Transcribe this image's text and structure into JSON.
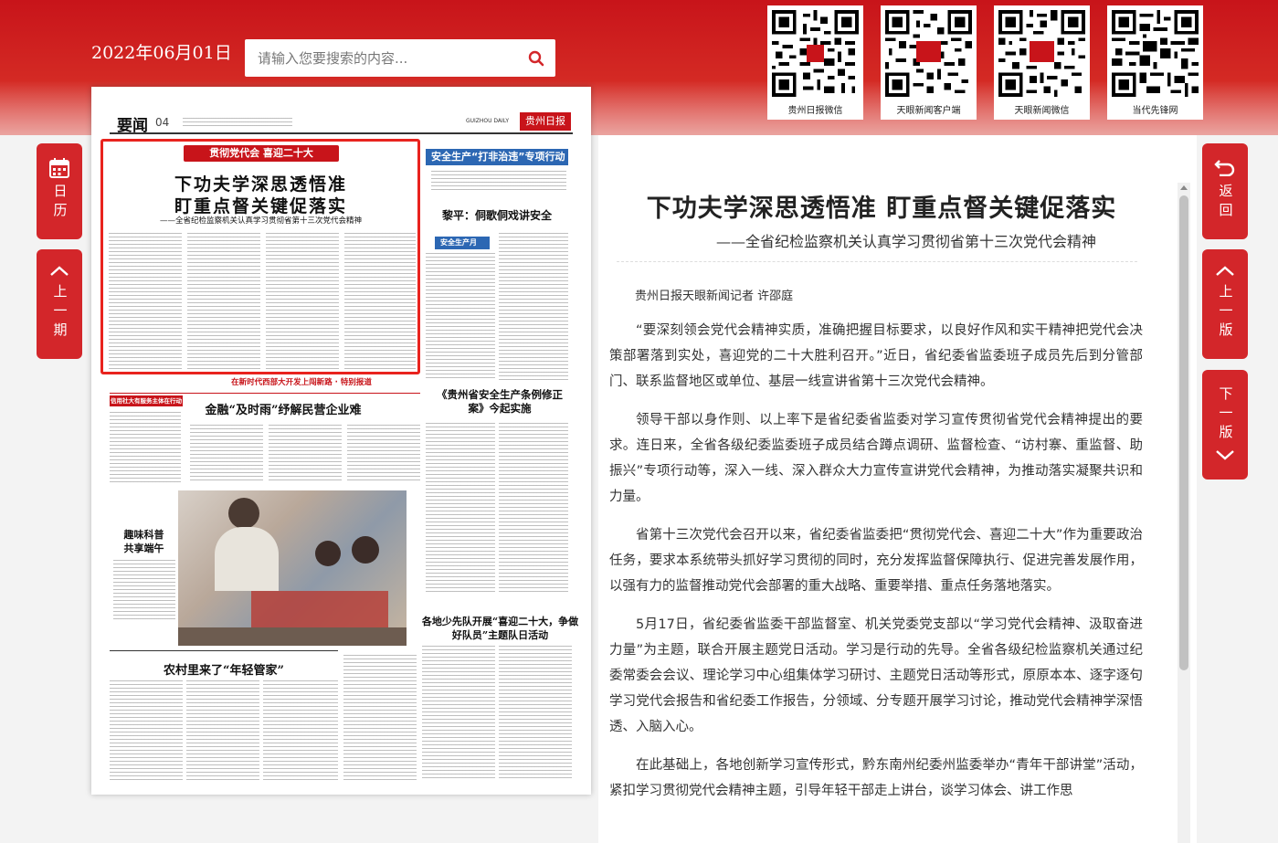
{
  "header": {
    "date": "2022年06月01日",
    "search_placeholder": "请输入您要搜索的内容..."
  },
  "qr_codes": [
    {
      "caption": "贵州日报微信"
    },
    {
      "caption": "天眼新闻客户端"
    },
    {
      "caption": "天眼新闻微信"
    },
    {
      "caption": "当代先锋网"
    }
  ],
  "nav": {
    "calendar_label": "日历",
    "prev_issue_label": "上一期",
    "back_label": "返回",
    "prev_page_label": "上一版",
    "next_page_label": "下一版"
  },
  "paper": {
    "section": "要闻",
    "page_no": "04",
    "masthead_en": "GUIZHOU DAILY",
    "masthead_logo": "贵州日报",
    "lead_banner": "贯彻党代会 喜迎二十大",
    "lead_title_1": "下功夫学深思透悟准",
    "lead_title_2": "盯重点督关键促落实",
    "lead_sub": "——全省纪检监察机关认真学习贯彻省第十三次党代会精神",
    "right_banner": "安全生产“打非治违”专项行动",
    "right_title": "黎平：侗歌侗戏讲安全",
    "right_small_banner": "安全生产月",
    "right_title_2": "《贵州省安全生产条例修正案》今起实施",
    "red_strip": "在新时代西部大开发上闯新路 · 特别报道",
    "left_banner": "信用社大有服务主体在行动",
    "finance_title": "金融“及时雨”纾解民营企业难",
    "fun_title_1": "趣味科普",
    "fun_title_2": "共享端午",
    "team_title": "各地少先队开展“喜迎二十大，争做好队员”主题队日活动",
    "village_title": "农村里来了“年轻管家”"
  },
  "article": {
    "title": "下功夫学深思透悟准 盯重点督关键促落实",
    "subtitle": "——全省纪检监察机关认真学习贯彻省第十三次党代会精神",
    "byline": "贵州日报天眼新闻记者 许邵庭",
    "paragraphs": [
      "“要深刻领会党代会精神实质，准确把握目标要求，以良好作风和实干精神把党代会决策部署落到实处，喜迎党的二十大胜利召开。”近日，省纪委省监委班子成员先后到分管部门、联系监督地区或单位、基层一线宣讲省第十三次党代会精神。",
      "领导干部以身作则、以上率下是省纪委省监委对学习宣传贯彻省党代会精神提出的要求。连日来，全省各级纪委监委班子成员结合蹲点调研、监督检查、“访村寨、重监督、助振兴”专项行动等，深入一线、深入群众大力宣传宣讲党代会精神，为推动落实凝聚共识和力量。",
      "省第十三次党代会召开以来，省纪委省监委把“贯彻党代会、喜迎二十大”作为重要政治任务，要求本系统带头抓好学习贯彻的同时，充分发挥监督保障执行、促进完善发展作用，以强有力的监督推动党代会部署的重大战略、重要举措、重点任务落地落实。",
      "5月17日，省纪委省监委干部监督室、机关党委党支部以“学习党代会精神、汲取奋进力量”为主题，联合开展主题党日活动。学习是行动的先导。全省各级纪检监察机关通过纪委常委会会议、理论学习中心组集体学习研讨、主题党日活动等形式，原原本本、逐字逐句学习党代会报告和省纪委工作报告，分领域、分专题开展学习讨论，推动党代会精神学深悟透、入脑入心。",
      "在此基础上，各地创新学习宣传形式，黔东南州纪委州监委举办“青年干部讲堂”活动，紧扣学习贯彻党代会精神主题，引导年轻干部走上讲台，谈学习体会、讲工作思"
    ]
  }
}
